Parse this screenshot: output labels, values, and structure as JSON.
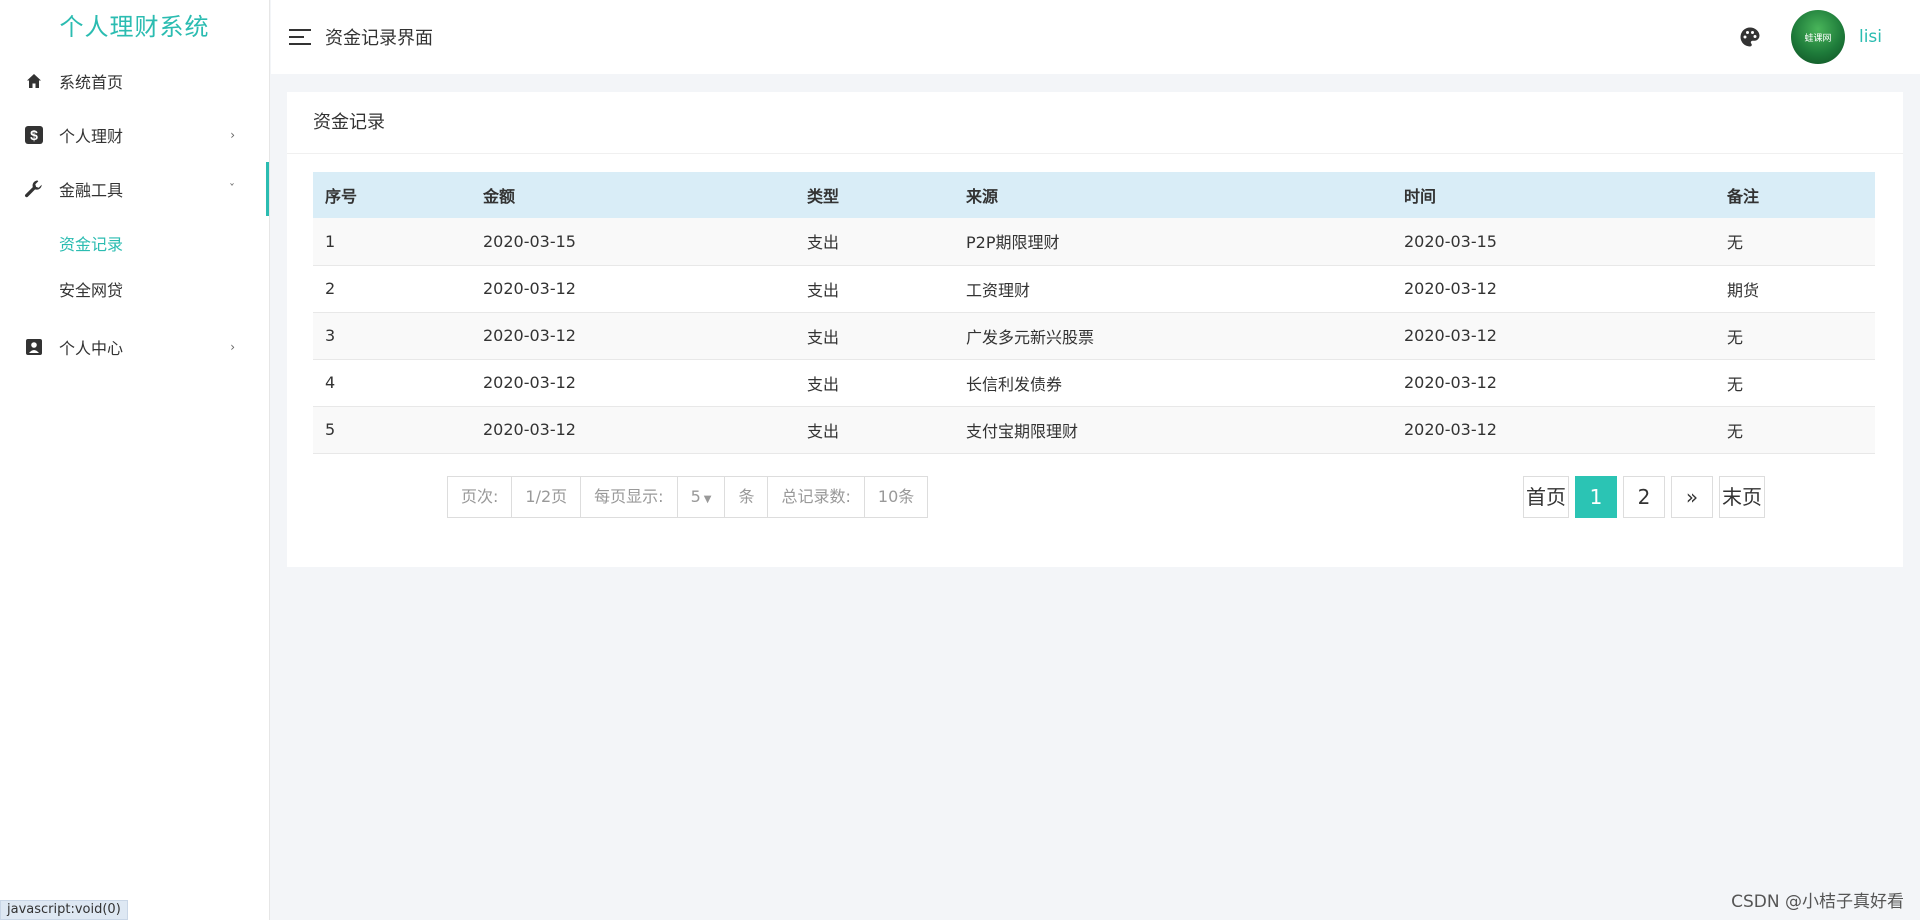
{
  "app": {
    "title": "个人理财系统"
  },
  "sidebar": {
    "items": [
      {
        "label": "系统首页",
        "icon": "home-icon"
      },
      {
        "label": "个人理财",
        "icon": "dollar-icon",
        "arrow": "›"
      },
      {
        "label": "金融工具",
        "icon": "wrench-icon",
        "arrow": "ˇ",
        "children": [
          {
            "label": "资金记录"
          },
          {
            "label": "安全网贷"
          }
        ]
      },
      {
        "label": "个人中心",
        "icon": "user-card-icon",
        "arrow": "›"
      }
    ]
  },
  "header": {
    "title": "资金记录界面",
    "username": "lisi",
    "avatar_text": "蛙课网"
  },
  "card": {
    "title": "资金记录"
  },
  "table": {
    "columns": [
      "序号",
      "金额",
      "类型",
      "来源",
      "时间",
      "备注"
    ],
    "rows": [
      [
        "1",
        "2020-03-15",
        "支出",
        "P2P期限理财",
        "2020-03-15",
        "无"
      ],
      [
        "2",
        "2020-03-12",
        "支出",
        "工资理财",
        "2020-03-12",
        "期货"
      ],
      [
        "3",
        "2020-03-12",
        "支出",
        "广发多元新兴股票",
        "2020-03-12",
        "无"
      ],
      [
        "4",
        "2020-03-12",
        "支出",
        "长信利发债券",
        "2020-03-12",
        "无"
      ],
      [
        "5",
        "2020-03-12",
        "支出",
        "支付宝期限理财",
        "2020-03-12",
        "无"
      ]
    ]
  },
  "pagination": {
    "page_label": "页次:",
    "page_value": "1/2页",
    "per_page_label": "每页显示:",
    "per_page_value": "5",
    "per_page_unit": "条",
    "total_label": "总记录数:",
    "total_value": "10条",
    "first": "首页",
    "pages": [
      "1",
      "2"
    ],
    "next": "»",
    "last": "末页"
  },
  "status_bar": "javascript:void(0)",
  "watermark": "CSDN @小桔子真好看",
  "colors": {
    "accent": "#2bbcb1",
    "table_header": "#d9edf7"
  }
}
